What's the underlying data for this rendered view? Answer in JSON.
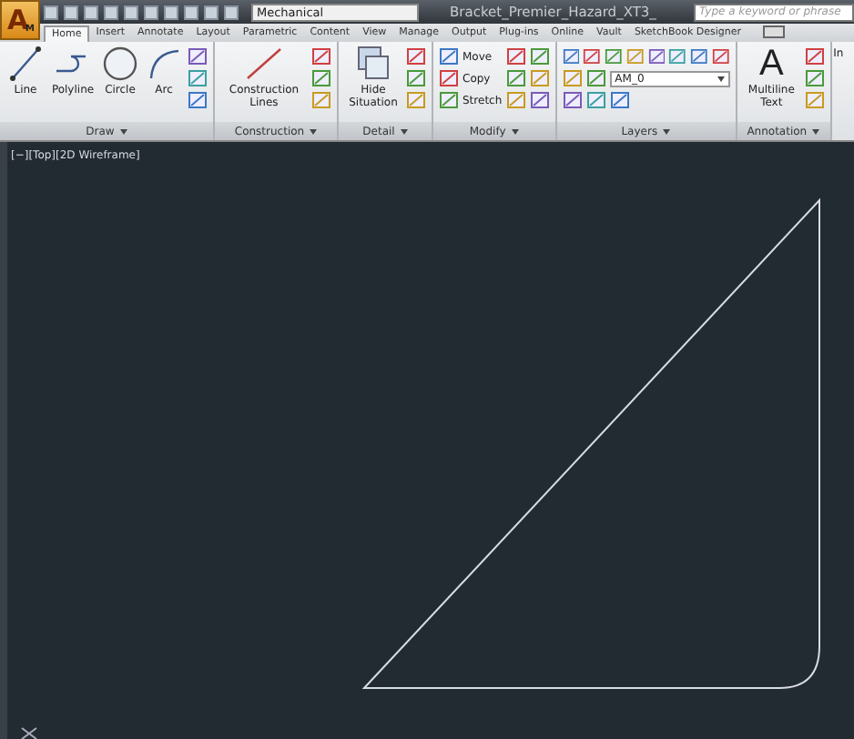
{
  "title_bar": {
    "app_button": {
      "label": "A",
      "badge": "M"
    },
    "workspace": "Mechanical",
    "document_title": "Bracket_Premier_Hazard_XT3_",
    "search": {
      "placeholder": "Type a keyword or phrase"
    }
  },
  "tabs": [
    {
      "label": "Home",
      "selected": true
    },
    {
      "label": "Insert",
      "selected": false
    },
    {
      "label": "Annotate",
      "selected": false
    },
    {
      "label": "Layout",
      "selected": false
    },
    {
      "label": "Parametric",
      "selected": false
    },
    {
      "label": "Content",
      "selected": false
    },
    {
      "label": "View",
      "selected": false
    },
    {
      "label": "Manage",
      "selected": false
    },
    {
      "label": "Output",
      "selected": false
    },
    {
      "label": "Plug-ins",
      "selected": false
    },
    {
      "label": "Online",
      "selected": false
    },
    {
      "label": "Vault",
      "selected": false
    },
    {
      "label": "SketchBook Designer",
      "selected": false
    }
  ],
  "ribbon": {
    "panels": [
      {
        "title": "Draw",
        "tools": [
          {
            "kind": "line",
            "label": "Line"
          },
          {
            "kind": "polyline",
            "label": "Polyline"
          },
          {
            "kind": "circle",
            "label": "Circle"
          },
          {
            "kind": "arc",
            "label": "Arc"
          },
          {
            "kind": "stack"
          }
        ]
      },
      {
        "title": "Construction",
        "tools": [
          {
            "kind": "xline",
            "label": "Construction Lines"
          },
          {
            "kind": "stack"
          }
        ]
      },
      {
        "title": "Detail",
        "tools": [
          {
            "kind": "hide",
            "label": "Hide Situation"
          },
          {
            "kind": "stack"
          }
        ]
      },
      {
        "title": "Modify",
        "tools": [
          {
            "kind": "labeled",
            "labels": [
              "Move",
              "Copy",
              "Stretch"
            ]
          },
          {
            "kind": "stack"
          },
          {
            "kind": "stack"
          }
        ]
      },
      {
        "title": "Layers",
        "tools": [
          {
            "kind": "layers",
            "layer": "AM_0"
          }
        ]
      },
      {
        "title": "Annotation",
        "tools": [
          {
            "kind": "mtext",
            "glyph": "A",
            "label": "Multiline Text"
          },
          {
            "kind": "stack"
          }
        ]
      }
    ],
    "partial_panel": {
      "tool_label": "In"
    }
  },
  "viewport": {
    "label": "[−][Top][2D Wireframe]"
  }
}
